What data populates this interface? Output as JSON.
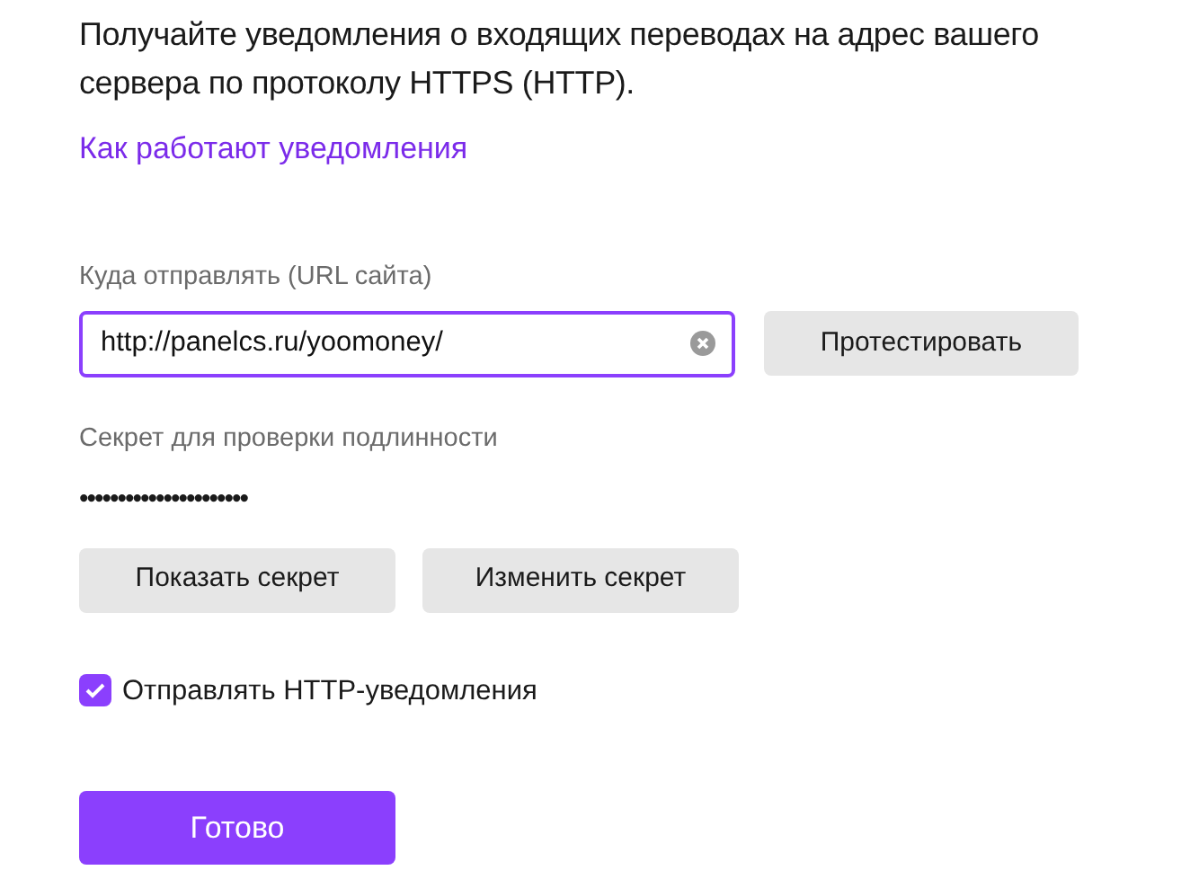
{
  "intro": "Получайте уведомления о входящих переводах на адрес вашего сервера по протоколу HTTPS (HTTP).",
  "help_link": "Как работают уведомления",
  "url_field": {
    "label": "Куда отправлять (URL сайта)",
    "value": "http://panelcs.ru/yoomoney/",
    "focused": true
  },
  "test_button": "Протестировать",
  "secret": {
    "label": "Секрет для проверки подлинности",
    "value": "••••••••••••••••••••••"
  },
  "secret_buttons": [
    "Показать секрет",
    "Изменить секрет"
  ],
  "send_checkbox": {
    "label": "Отправлять HTTP-уведомления",
    "checked": true
  },
  "done_button": "Готово"
}
